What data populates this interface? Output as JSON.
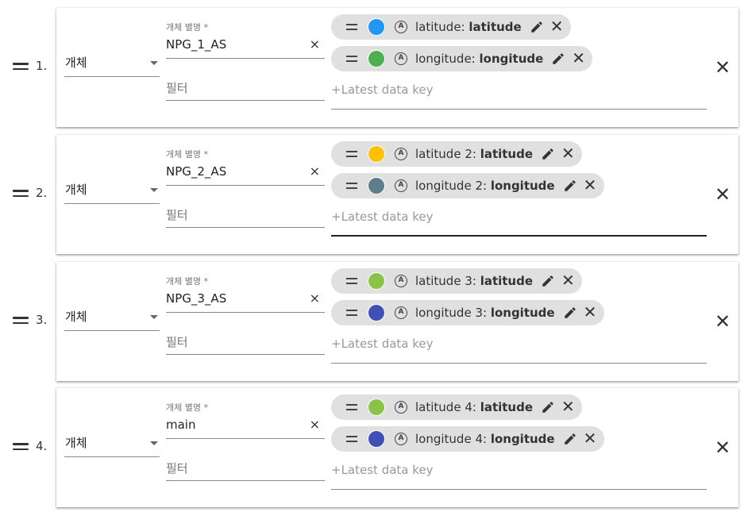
{
  "labels": {
    "entity_select": "개체",
    "alias_label": "개체 별명 *",
    "filter_placeholder": "필터",
    "datakey_placeholder": "+Latest data key",
    "clear_symbol": "×",
    "remove_symbol": "✕"
  },
  "datasources": [
    {
      "index": "1.",
      "alias": "NPG_1_AS",
      "keys": [
        {
          "label": "latitude: ",
          "key": "latitude",
          "color": "#2196f3"
        },
        {
          "label": "longitude: ",
          "key": "longitude",
          "color": "#4caf50"
        }
      ]
    },
    {
      "index": "2.",
      "alias": "NPG_2_AS",
      "keys": [
        {
          "label": "latitude 2: ",
          "key": "latitude",
          "color": "#ffc107"
        },
        {
          "label": "longitude 2: ",
          "key": "longitude",
          "color": "#607d8b"
        }
      ]
    },
    {
      "index": "3.",
      "alias": "NPG_3_AS",
      "keys": [
        {
          "label": "latitude 3: ",
          "key": "latitude",
          "color": "#8bc34a"
        },
        {
          "label": "longitude 3: ",
          "key": "longitude",
          "color": "#3f51b5"
        }
      ]
    },
    {
      "index": "4.",
      "alias": "main",
      "keys": [
        {
          "label": "latitude 4: ",
          "key": "latitude",
          "color": "#8bc34a"
        },
        {
          "label": "longitude 4: ",
          "key": "longitude",
          "color": "#3f51b5"
        }
      ]
    }
  ],
  "icons": {
    "drag_handle": "drag-handle-icon",
    "type_badge": "attribute-type-icon",
    "edit": "pencil-icon",
    "remove": "close-icon",
    "dropdown": "chevron-down-icon"
  }
}
